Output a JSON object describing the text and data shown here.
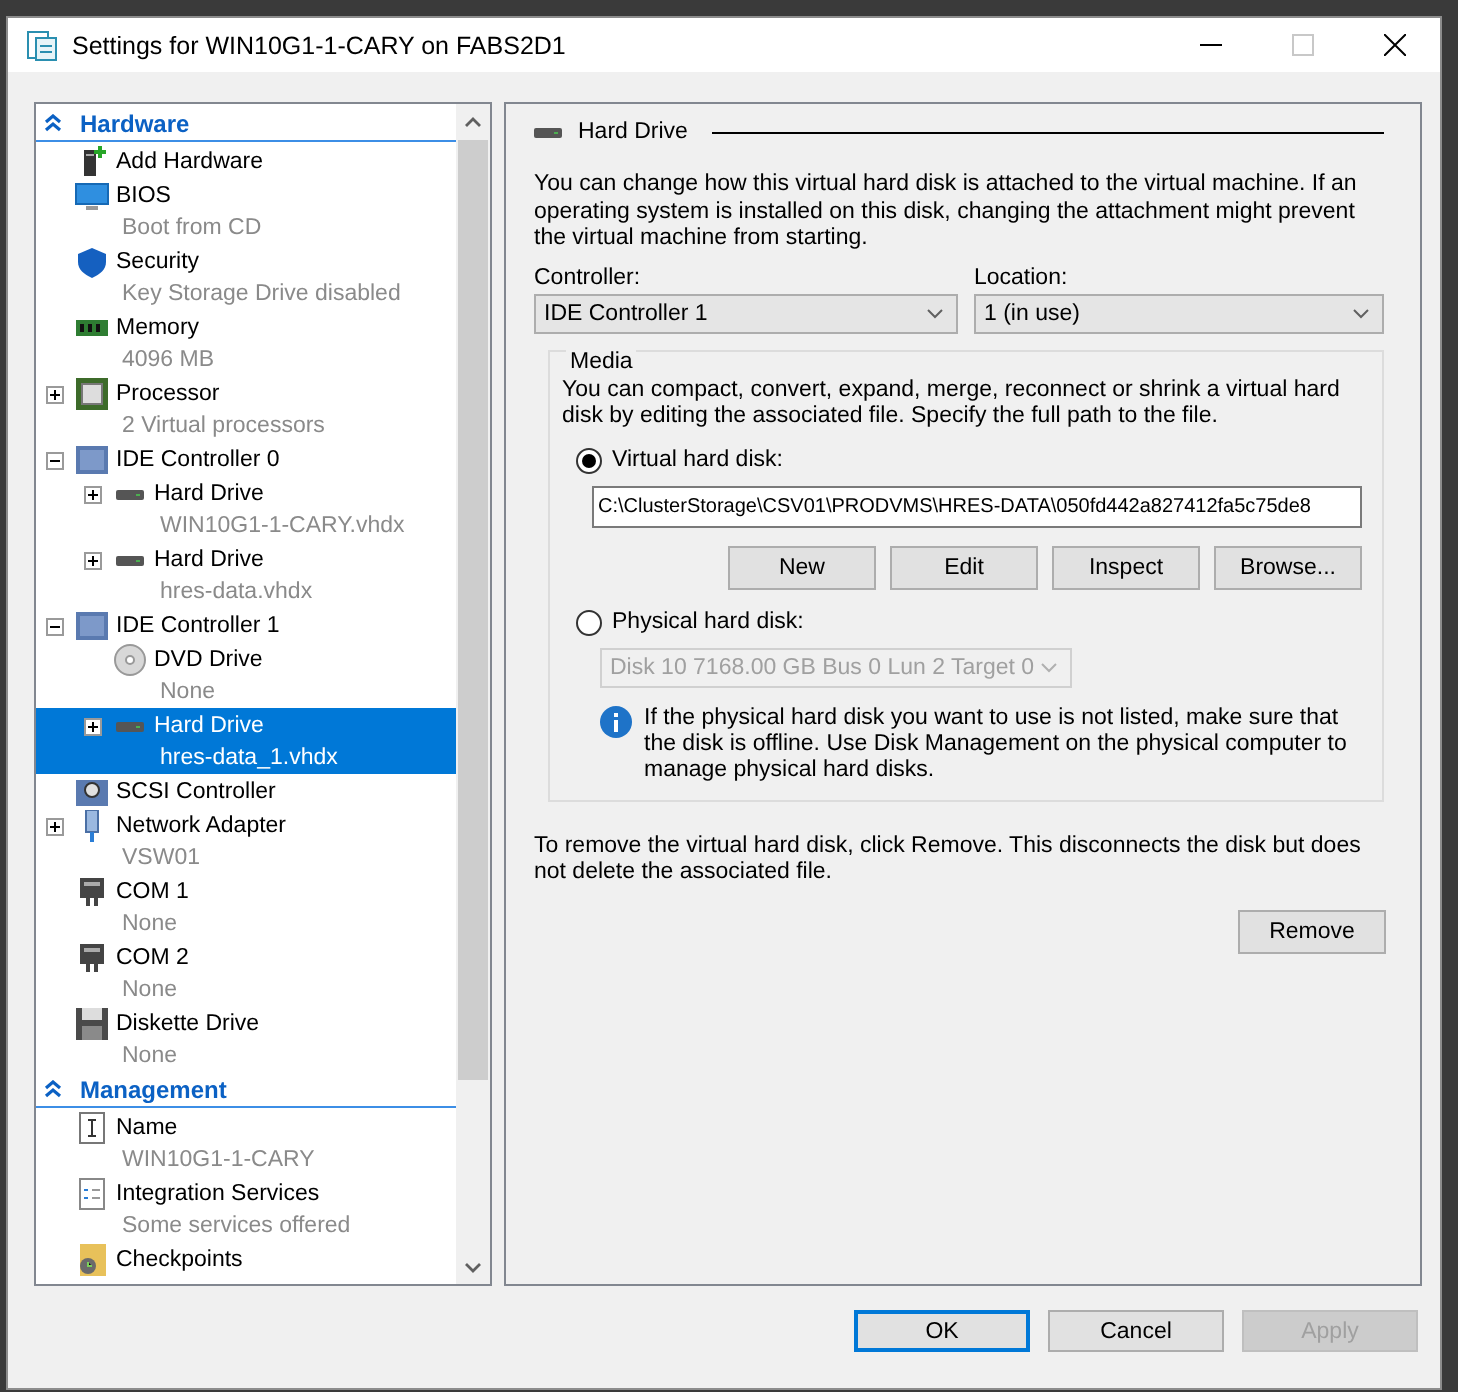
{
  "window": {
    "title": "Settings for WIN10G1-1-CARY on FABS2D1"
  },
  "sidebar": {
    "sections": [
      {
        "title": "Hardware",
        "expanded": true,
        "items": [
          {
            "kind": "add-hardware",
            "label": "Add Hardware",
            "selected": false
          },
          {
            "kind": "bios",
            "label": "BIOS",
            "detail": "Boot from CD",
            "selected": false
          },
          {
            "kind": "security",
            "label": "Security",
            "detail": "Key Storage Drive disabled",
            "selected": false
          },
          {
            "kind": "memory",
            "label": "Memory",
            "detail": "4096 MB",
            "selected": false
          },
          {
            "kind": "processor",
            "label": "Processor",
            "detail": "2 Virtual processors",
            "expanded": false,
            "selected": false
          },
          {
            "kind": "controller",
            "label": "IDE Controller 0",
            "expanded": true,
            "selected": false,
            "children": [
              {
                "kind": "hard-drive",
                "label": "Hard Drive",
                "detail": "WIN10G1-1-CARY.vhdx",
                "expanded": false,
                "selected": false
              },
              {
                "kind": "hard-drive",
                "label": "Hard Drive",
                "detail": "hres-data.vhdx",
                "expanded": false,
                "selected": false
              }
            ]
          },
          {
            "kind": "controller",
            "label": "IDE Controller 1",
            "expanded": true,
            "selected": false,
            "children": [
              {
                "kind": "dvd",
                "label": "DVD Drive",
                "detail": "None",
                "selected": false
              },
              {
                "kind": "hard-drive",
                "label": "Hard Drive",
                "detail": "hres-data_1.vhdx",
                "expanded": false,
                "selected": true
              }
            ]
          },
          {
            "kind": "scsi",
            "label": "SCSI Controller",
            "selected": false
          },
          {
            "kind": "network",
            "label": "Network Adapter",
            "detail": "VSW01",
            "expanded": false,
            "selected": false
          },
          {
            "kind": "com",
            "label": "COM 1",
            "detail": "None",
            "selected": false
          },
          {
            "kind": "com",
            "label": "COM 2",
            "detail": "None",
            "selected": false
          },
          {
            "kind": "diskette",
            "label": "Diskette Drive",
            "detail": "None",
            "selected": false
          }
        ]
      },
      {
        "title": "Management",
        "expanded": true,
        "items": [
          {
            "kind": "name",
            "label": "Name",
            "detail": "WIN10G1-1-CARY",
            "selected": false
          },
          {
            "kind": "integration",
            "label": "Integration Services",
            "detail": "Some services offered",
            "selected": false
          },
          {
            "kind": "checkpoints",
            "label": "Checkpoints",
            "selected": false
          }
        ]
      }
    ]
  },
  "detail": {
    "title": "Hard Drive",
    "description": "You can change how this virtual hard disk is attached to the virtual machine. If an operating system is installed on this disk, changing the attachment might prevent the virtual machine from starting.",
    "controller": {
      "label": "Controller:",
      "value": "IDE Controller 1"
    },
    "location": {
      "label": "Location:",
      "value": "1 (in use)"
    },
    "media": {
      "title": "Media",
      "description": "You can compact, convert, expand, merge, reconnect or shrink a virtual hard disk by editing the associated file. Specify the full path to the file.",
      "options": [
        {
          "kind": "virtual",
          "label": "Virtual hard disk:",
          "selected": true,
          "path": "C:\\ClusterStorage\\CSV01\\PRODVMS\\HRES-DATA\\050fd442a827412fa5c75de8",
          "buttons": [
            "New",
            "Edit",
            "Inspect",
            "Browse..."
          ]
        },
        {
          "kind": "physical",
          "label": "Physical hard disk:",
          "selected": false,
          "disk": {
            "value": "Disk 10 7168.00 GB Bus 0 Lun 2 Target 0",
            "disabled": true
          },
          "info": "If the physical hard disk you want to use is not listed, make sure that the disk is offline. Use Disk Management on the physical computer to manage physical hard disks."
        }
      ]
    },
    "remove_text": "To remove the virtual hard disk, click Remove. This disconnects the disk but does not delete the associated file.",
    "remove_button": "Remove"
  },
  "buttons": [
    {
      "label": "OK",
      "default": true,
      "disabled": false
    },
    {
      "label": "Cancel",
      "default": false,
      "disabled": false
    },
    {
      "label": "Apply",
      "default": false,
      "disabled": true
    }
  ]
}
